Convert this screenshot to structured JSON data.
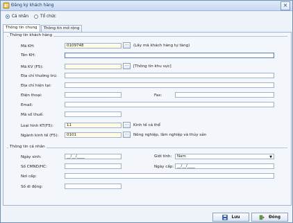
{
  "window": {
    "title": "Đăng ký khách hàng",
    "close_symbol": "×"
  },
  "customer_type": {
    "options": [
      "Cá nhân",
      "Tổ chức"
    ],
    "selected": "Cá nhân"
  },
  "tabs": [
    {
      "label": "Thông tin chung",
      "active": true
    },
    {
      "label": "Thông tin mở rộng",
      "active": false
    }
  ],
  "sections": {
    "customer": "Thông tin khách hàng",
    "personal": "Thông tin cá nhân"
  },
  "fields": {
    "ma_kh": {
      "label": "Mã KH:",
      "value": "0109748",
      "hint": "(Lấy mã khách hàng tự tăng)"
    },
    "ten_kh": {
      "label": "Tên KH:",
      "value": ""
    },
    "ma_kv": {
      "label": "Mã KV (F5):",
      "value": "",
      "hint": "[Thông tin khu vực]"
    },
    "dia_chi_thuong_tru": {
      "label": "Địa chỉ thường trú:",
      "value": ""
    },
    "dia_chi_hien_tai": {
      "label": "Địa chỉ hiện tại:",
      "value": ""
    },
    "dien_thoai": {
      "label": "Điện thoại:",
      "value": ""
    },
    "fax": {
      "label": "Fax:",
      "value": ""
    },
    "email": {
      "label": "Email:",
      "value": ""
    },
    "ma_so_thue": {
      "label": "Mã số thuế:",
      "value": ""
    },
    "loai_hinh_kt": {
      "label": "Loại hình KT(F5):",
      "value": "11",
      "hint": "Kinh tế cá thể"
    },
    "nganh_kinh_te": {
      "label": "Ngành kinh tế (F5):",
      "value": "0101",
      "hint": "Nông nghiệp, lâm nghiệp và thủy sản"
    },
    "ngay_sinh": {
      "label": "Ngày sinh:",
      "value": "__/__/____"
    },
    "gioi_tinh": {
      "label": "Giới tính:",
      "value": "Nam"
    },
    "so_cmnd": {
      "label": "Số CMND/HC:",
      "value": ""
    },
    "ngay_cap": {
      "label": "Ngày cấp:",
      "value": "__/__/____"
    },
    "noi_cap": {
      "label": "Nơi cấp:",
      "value": ""
    },
    "so_di_dong": {
      "label": "Số di động:",
      "value": ""
    }
  },
  "lookup_label": "...",
  "buttons": {
    "save": "Lưu",
    "close": "Đóng"
  },
  "colors": {
    "accent": "#1d7ad6",
    "required_field_bg": "#fffbe4"
  }
}
